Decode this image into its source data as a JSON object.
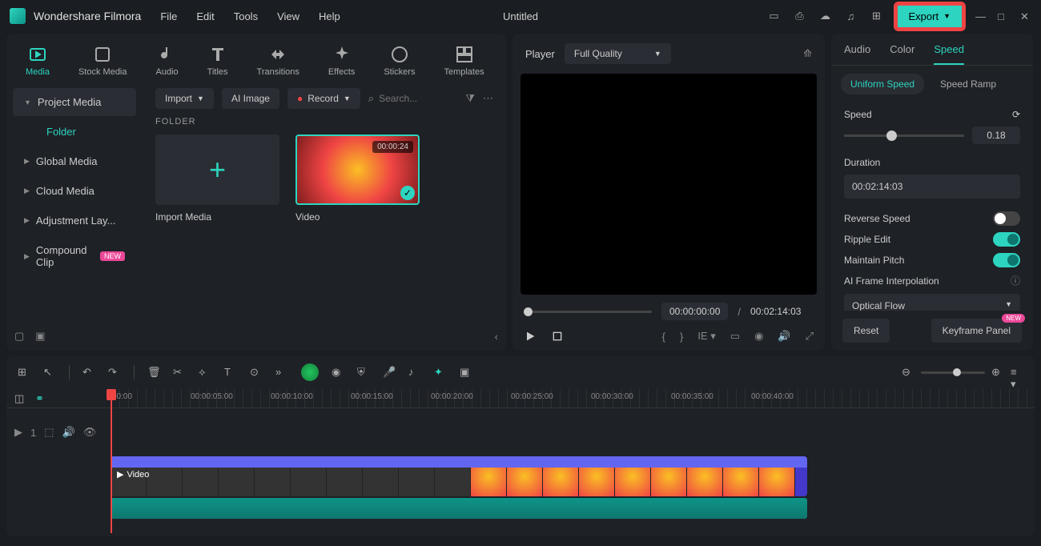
{
  "app": {
    "name": "Wondershare Filmora",
    "document": "Untitled"
  },
  "menu": [
    "File",
    "Edit",
    "Tools",
    "View",
    "Help"
  ],
  "export": {
    "label": "Export"
  },
  "tabs": [
    {
      "label": "Media",
      "active": true
    },
    {
      "label": "Stock Media"
    },
    {
      "label": "Audio"
    },
    {
      "label": "Titles"
    },
    {
      "label": "Transitions"
    },
    {
      "label": "Effects"
    },
    {
      "label": "Stickers"
    },
    {
      "label": "Templates"
    }
  ],
  "sidebar": {
    "header": "Project Media",
    "folder_label": "Folder",
    "items": [
      {
        "label": "Global Media"
      },
      {
        "label": "Cloud Media"
      },
      {
        "label": "Adjustment Lay..."
      },
      {
        "label": "Compound Clip",
        "new": true
      }
    ]
  },
  "toolbar": {
    "import": "Import",
    "ai_image": "AI Image",
    "record": "Record",
    "search_placeholder": "Search..."
  },
  "folder_heading": "FOLDER",
  "thumbs": {
    "import_media": "Import Media",
    "video": "Video",
    "duration": "00:00:24"
  },
  "preview": {
    "player": "Player",
    "quality": "Full Quality",
    "current": "00:00:00:00",
    "total": "00:02:14:03",
    "sep": "/"
  },
  "right": {
    "tabs": [
      "Audio",
      "Color",
      "Speed"
    ],
    "subtabs": [
      "Uniform Speed",
      "Speed Ramp"
    ],
    "speed_label": "Speed",
    "speed_value": "0.18",
    "duration_label": "Duration",
    "duration_value": "00:02:14:03",
    "reverse_label": "Reverse Speed",
    "ripple_label": "Ripple Edit",
    "pitch_label": "Maintain Pitch",
    "ai_frame_label": "AI Frame Interpolation",
    "interp_value": "Optical Flow",
    "reset": "Reset",
    "keyframe": "Keyframe Panel",
    "new": "NEW"
  },
  "timeline": {
    "ticks": [
      "00:00",
      "00:00:05:00",
      "00:00:10:00",
      "00:00:15:00",
      "00:00:20:00",
      "00:00:25:00",
      "00:00:30:00",
      "00:00:35:00",
      "00:00:40:00"
    ],
    "clip_label": "Video",
    "track_count": "1"
  }
}
